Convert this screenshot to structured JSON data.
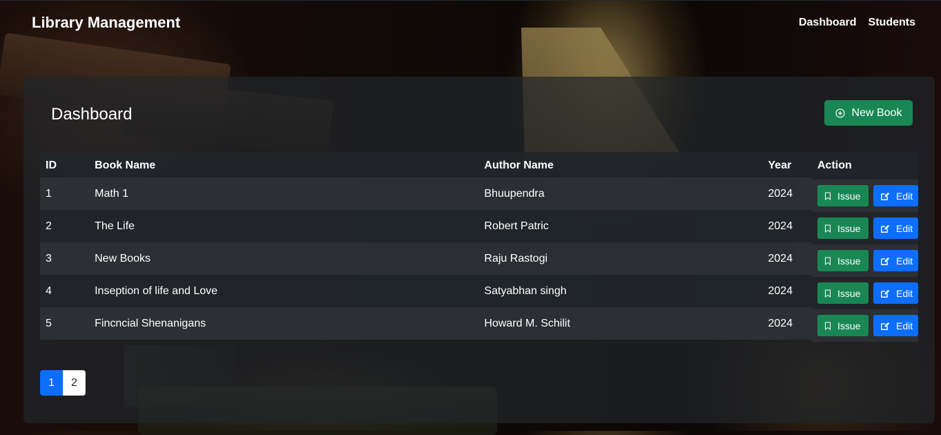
{
  "navbar": {
    "brand": "Library Management",
    "links": [
      "Dashboard",
      "Students"
    ]
  },
  "card": {
    "title": "Dashboard",
    "new_book_label": "New Book"
  },
  "table": {
    "headers": [
      "ID",
      "Book Name",
      "Author Name",
      "Year",
      "Action"
    ],
    "rows": [
      {
        "id": "1",
        "name": "Math 1",
        "author": "Bhuupendra",
        "year": "2024"
      },
      {
        "id": "2",
        "name": "The Life",
        "author": "Robert Patric",
        "year": "2024"
      },
      {
        "id": "3",
        "name": "New Books",
        "author": "Raju Rastogi",
        "year": "2024"
      },
      {
        "id": "4",
        "name": "Inseption of life and Love",
        "author": "Satyabhan singh",
        "year": "2024"
      },
      {
        "id": "5",
        "name": "Fincncial Shenanigans",
        "author": "Howard M. Schilit",
        "year": "2024"
      }
    ],
    "issue_label": "Issue",
    "edit_label": "Edit"
  },
  "pagination": {
    "pages": [
      "1",
      "2"
    ],
    "active": "1"
  },
  "icons": {
    "new_book": "plus-circle-icon",
    "issue": "bookmark-icon",
    "edit": "pencil-square-icon"
  },
  "colors": {
    "success": "#198754",
    "primary": "#0d6efd",
    "dark": "#212529"
  }
}
